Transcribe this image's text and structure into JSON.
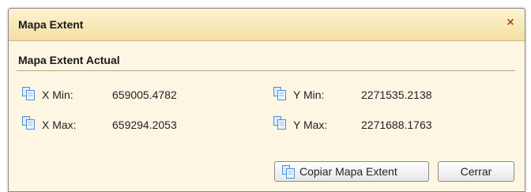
{
  "dialog": {
    "title": "Mapa Extent",
    "close_icon": "×",
    "section_title": "Mapa Extent Actual",
    "xmin_label": "X Min:",
    "xmin_value": "659005.4782",
    "ymin_label": "Y Min:",
    "ymin_value": "2271535.2138",
    "xmax_label": "X Max:",
    "xmax_value": "659294.2053",
    "ymax_label": "Y Max:",
    "ymax_value": "2271688.1763",
    "copy_button_label": "Copiar Mapa Extent",
    "close_button_label": "Cerrar"
  },
  "icons": {
    "copy": "copy-icon",
    "close": "close-icon"
  },
  "colors": {
    "dialog_background": "#fcf6e3",
    "titlebar_top": "#fdf3d3",
    "titlebar_bottom": "#f3dfa1",
    "close_color": "#a0521e",
    "icon_blue": "#6aa6e8"
  }
}
